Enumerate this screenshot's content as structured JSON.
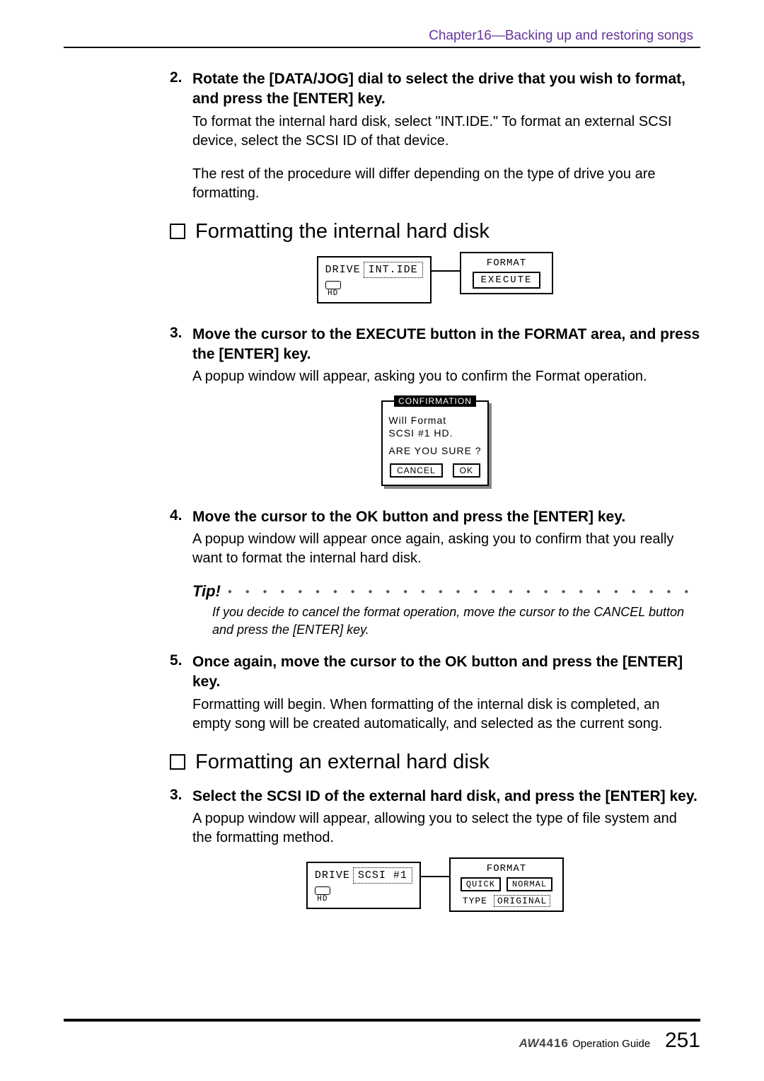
{
  "chapter": "Chapter16—Backing up and restoring songs",
  "step2": {
    "num": "2.",
    "title": "Rotate the [DATA/JOG] dial to select the drive that you wish to format, and press the [ENTER] key.",
    "body": "To format the internal hard disk, select \"INT.IDE.\" To format an external SCSI device, select the SCSI ID of that device.",
    "note": "The rest of the procedure will differ depending on the type of drive you are formatting."
  },
  "sectionA": "Formatting the internal hard disk",
  "diag1": {
    "driveLabel": "DRIVE",
    "driveValue": "INT.IDE",
    "hdLabel": "HD",
    "formatLabel": "FORMAT",
    "executeBtn": "EXECUTE"
  },
  "step3": {
    "num": "3.",
    "title": "Move the cursor to the EXECUTE button in the FORMAT area, and press the [ENTER] key.",
    "body": "A popup window will appear, asking you to confirm the Format operation."
  },
  "confirm": {
    "title": "CONFIRMATION",
    "line1": "Will Format",
    "line2": "SCSI #1  HD.",
    "sure": "ARE YOU SURE ?",
    "cancel": "CANCEL",
    "ok": "OK"
  },
  "step4": {
    "num": "4.",
    "title": "Move the cursor to the OK button and press the [ENTER] key.",
    "body": "A popup window will appear once again, asking you to confirm that you really want to format the internal hard disk."
  },
  "tip": {
    "label": "Tip!",
    "dots": "● ● ● ● ● ● ● ● ● ● ● ● ● ● ● ● ● ● ● ● ● ● ● ● ● ● ● ● ● ● ● ● ● ● ● ● ● ● ● ● ● ● ●",
    "text": "If you decide to cancel the format operation, move the cursor to the CANCEL button and press the [ENTER] key."
  },
  "step5": {
    "num": "5.",
    "title": "Once again, move the cursor to the OK button and press the [ENTER] key.",
    "body": "Formatting will begin. When formatting of the internal disk is completed, an empty song will be created automatically, and selected as the current song."
  },
  "sectionB": "Formatting an external hard disk",
  "step3b": {
    "num": "3.",
    "title": "Select the SCSI ID of the external hard disk, and press the [ENTER] key.",
    "body": "A popup window will appear, allowing you to select the type of file system and the formatting method."
  },
  "diag2": {
    "driveLabel": "DRIVE",
    "driveValue": "SCSI #1",
    "hdLabel": "HD",
    "formatLabel": "FORMAT",
    "quickBtn": "QUICK",
    "normalBtn": "NORMAL",
    "typeLabel": "TYPE",
    "typeValue": "ORIGINAL"
  },
  "footer": {
    "model1": "AW",
    "model2": "4416",
    "guide": "Operation Guide",
    "page": "251"
  }
}
